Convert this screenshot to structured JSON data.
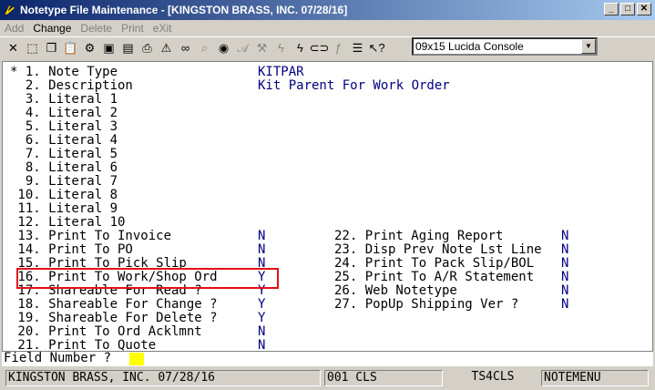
{
  "window": {
    "title": "Notetype File Maintenance - [KINGSTON BRASS, INC. 07/28/16]"
  },
  "menu": [
    {
      "label": "Add",
      "enabled": false
    },
    {
      "label": "Change",
      "enabled": true
    },
    {
      "label": "Delete",
      "enabled": false
    },
    {
      "label": "Print",
      "enabled": false
    },
    {
      "label": "eXit",
      "enabled": false
    }
  ],
  "toolbar": {
    "font_selected": "09x15 Lucida Console"
  },
  "screen": {
    "left_fields": [
      {
        "label": "* 1. Note Type",
        "value": "KITPAR"
      },
      {
        "label": "  2. Description",
        "value": "Kit Parent For Work Order"
      },
      {
        "label": "  3. Literal 1",
        "value": ""
      },
      {
        "label": "  4. Literal 2",
        "value": ""
      },
      {
        "label": "  5. Literal 3",
        "value": ""
      },
      {
        "label": "  6. Literal 4",
        "value": ""
      },
      {
        "label": "  7. Literal 5",
        "value": ""
      },
      {
        "label": "  8. Literal 6",
        "value": ""
      },
      {
        "label": "  9. Literal 7",
        "value": ""
      },
      {
        "label": " 10. Literal 8",
        "value": ""
      },
      {
        "label": " 11. Literal 9",
        "value": ""
      },
      {
        "label": " 12. Literal 10",
        "value": ""
      },
      {
        "label": " 13. Print To Invoice",
        "value": "N"
      },
      {
        "label": " 14. Print To PO",
        "value": "N"
      },
      {
        "label": " 15. Print To Pick Slip",
        "value": "N"
      },
      {
        "label": " 16. Print To Work/Shop Ord",
        "value": "Y"
      },
      {
        "label": " 17. Shareable For Read ?",
        "value": "Y"
      },
      {
        "label": " 18. Shareable For Change ?",
        "value": "Y"
      },
      {
        "label": " 19. Shareable For Delete ?",
        "value": "Y"
      },
      {
        "label": " 20. Print To Ord Acklmnt",
        "value": "N"
      },
      {
        "label": " 21. Print To Quote",
        "value": "N"
      }
    ],
    "right_fields": [
      {
        "label": "22. Print Aging Report",
        "value": "N"
      },
      {
        "label": "23. Disp Prev Note Lst Line",
        "value": "N"
      },
      {
        "label": "24. Print To Pack Slip/BOL",
        "value": "N"
      },
      {
        "label": "25. Print To A/R Statement",
        "value": "N"
      },
      {
        "label": "26. Web Notetype",
        "value": "N"
      },
      {
        "label": "27. PopUp Shipping Ver ?",
        "value": "N"
      }
    ],
    "prompt": "Field Number ?"
  },
  "status": {
    "company": "KINGSTON BRASS, INC. 07/28/16",
    "code": "001 CLS",
    "terminal": "TS4CLS",
    "menu": "NOTEMENU"
  }
}
